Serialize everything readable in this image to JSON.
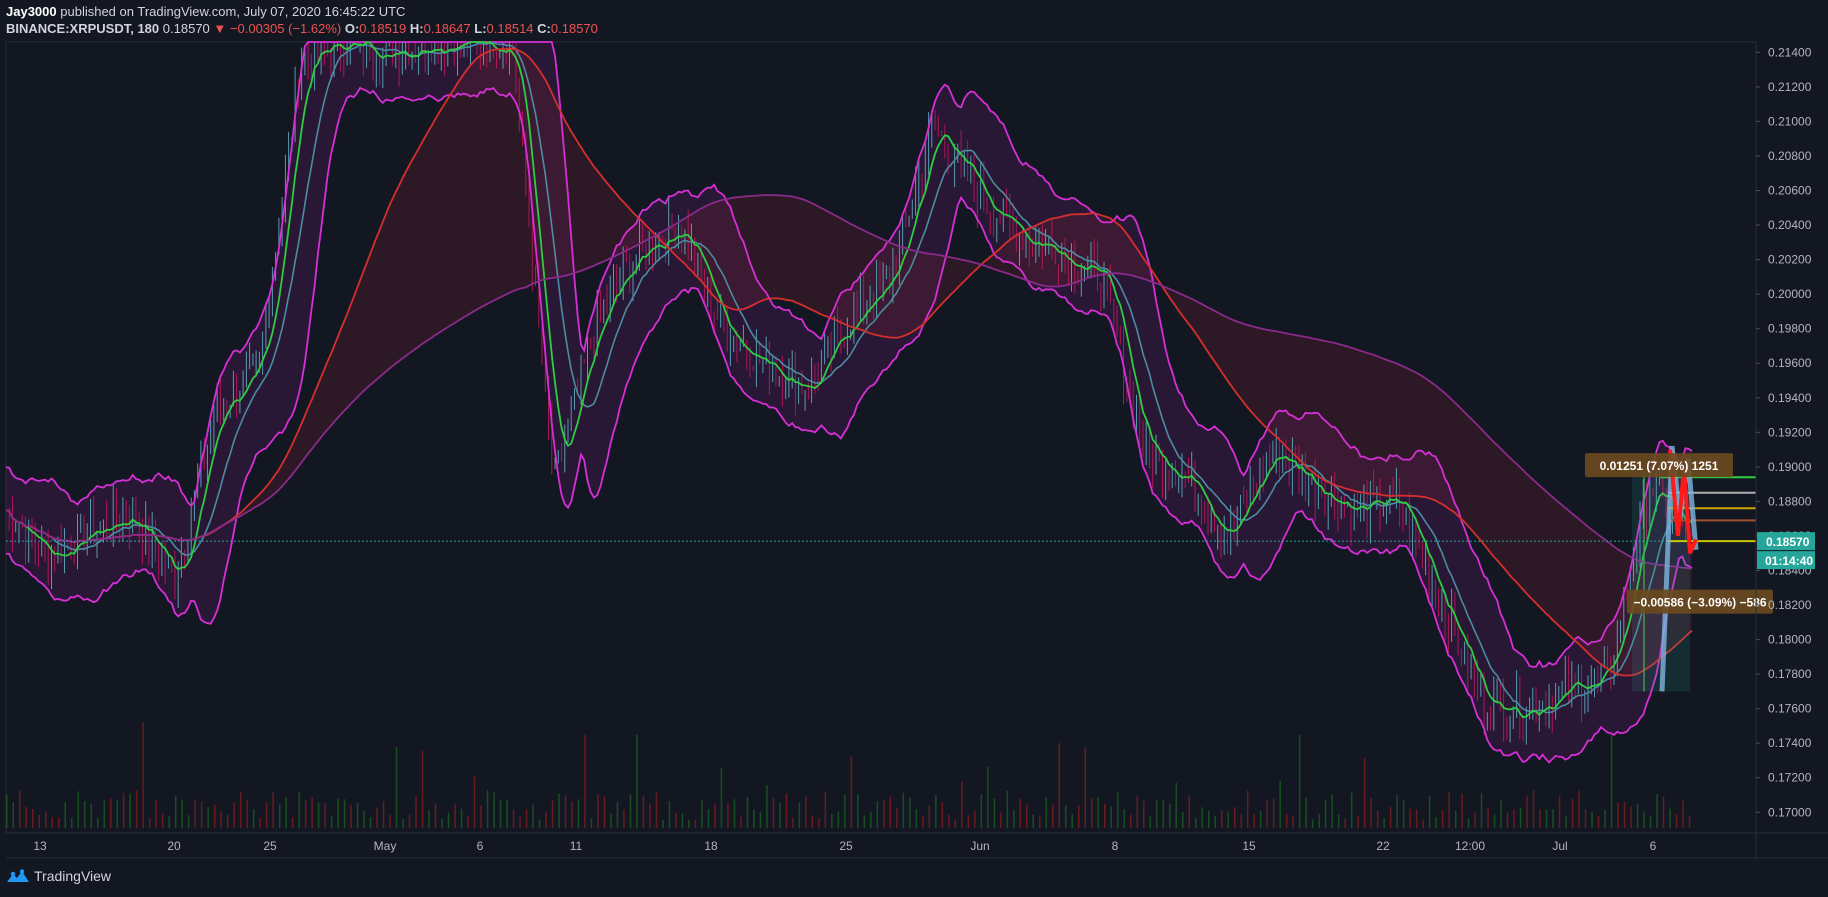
{
  "header": {
    "author": "Jay3000",
    "published": "published on TradingView.com, July 07, 2020 16:45:22 UTC",
    "symbol": "BINANCE:XRPUSDT, 180",
    "last": "0.18570",
    "arrow": "▼",
    "change": "−0.00305 (−1.62%)",
    "o_label": "O:",
    "o_value": "0.18519",
    "h_label": "H:",
    "h_value": "0.18647",
    "l_label": "L:",
    "l_value": "0.18514",
    "c_label": "C:",
    "c_value": "0.18570"
  },
  "brand": {
    "name": "TradingView",
    "icon": "tradingview-logo-icon"
  },
  "colors": {
    "background": "#131722",
    "grid": "#1e222d",
    "axis_text": "#b2b5be",
    "up": "#26a69a",
    "down": "#ef5350",
    "cyan_candle": "#5fb3c4",
    "ma_fast": "#2ecc40",
    "ma_slow": "#4a8ca0",
    "band": "#d62fd6",
    "ma_red": "#d32f2f",
    "ma_purple": "#8a2a8a",
    "last_price_tag": "#26a69a"
  },
  "chart_data": {
    "type": "line",
    "title": "BINANCE:XRPUSDT, 180",
    "xlabel": "",
    "ylabel": "",
    "ylim": [
      0.1688,
      0.2146
    ],
    "y_ticks": [
      "0.21400",
      "0.21200",
      "0.21000",
      "0.20800",
      "0.20600",
      "0.20400",
      "0.20200",
      "0.20000",
      "0.19800",
      "0.19600",
      "0.19400",
      "0.19200",
      "0.19000",
      "0.18800",
      "0.18600",
      "0.18400",
      "0.18200",
      "0.18000",
      "0.17800",
      "0.17600",
      "0.17400",
      "0.17200",
      "0.17000"
    ],
    "x_ticks": [
      "13",
      "20",
      "25",
      "May",
      "6",
      "11",
      "18",
      "25",
      "Jun",
      "8",
      "15",
      "22",
      "12:00",
      "Jul",
      "6"
    ],
    "x_tick_positions_idx": [
      0,
      7,
      12,
      18,
      23,
      28,
      35,
      42,
      49,
      56,
      63,
      70,
      74,
      78,
      84
    ],
    "series": [
      {
        "type": "price",
        "x": [
          "Apr 13",
          "Apr 15",
          "Apr 17",
          "Apr 20",
          "Apr 22",
          "Apr 25",
          "Apr 27",
          "Apr 29",
          "May 1",
          "May 3",
          "May 6",
          "May 8",
          "May 10",
          "May 11",
          "May 13",
          "May 16",
          "May 18",
          "May 20",
          "May 22",
          "May 25",
          "May 27",
          "May 29",
          "Jun 1",
          "Jun 3",
          "Jun 5",
          "Jun 8",
          "Jun 10",
          "Jun 11",
          "Jun 13",
          "Jun 15",
          "Jun 17",
          "Jun 19",
          "Jun 22",
          "Jun 24",
          "Jun 26",
          "Jun 29",
          "Jul 1",
          "Jul 3",
          "Jul 5",
          "Jul 6",
          "Jul 7"
        ],
        "values": [
          0.1875,
          0.1848,
          0.1862,
          0.1872,
          0.1835,
          0.1935,
          0.1955,
          0.2135,
          0.2146,
          0.214,
          0.2146,
          0.2146,
          0.2146,
          0.189,
          0.1985,
          0.2025,
          0.204,
          0.198,
          0.196,
          0.1945,
          0.1985,
          0.201,
          0.2098,
          0.206,
          0.2035,
          0.2025,
          0.201,
          0.191,
          0.1895,
          0.186,
          0.191,
          0.189,
          0.1875,
          0.188,
          0.1825,
          0.1765,
          0.176,
          0.177,
          0.178,
          0.189,
          0.1857
        ]
      }
    ],
    "last_price": 0.1857,
    "countdown": "01:14:40",
    "measure_up": "0.01251 (7.07%) 1251",
    "measure_down": "−0.00586 (−3.09%) −586",
    "grid": false,
    "legend": "none"
  }
}
